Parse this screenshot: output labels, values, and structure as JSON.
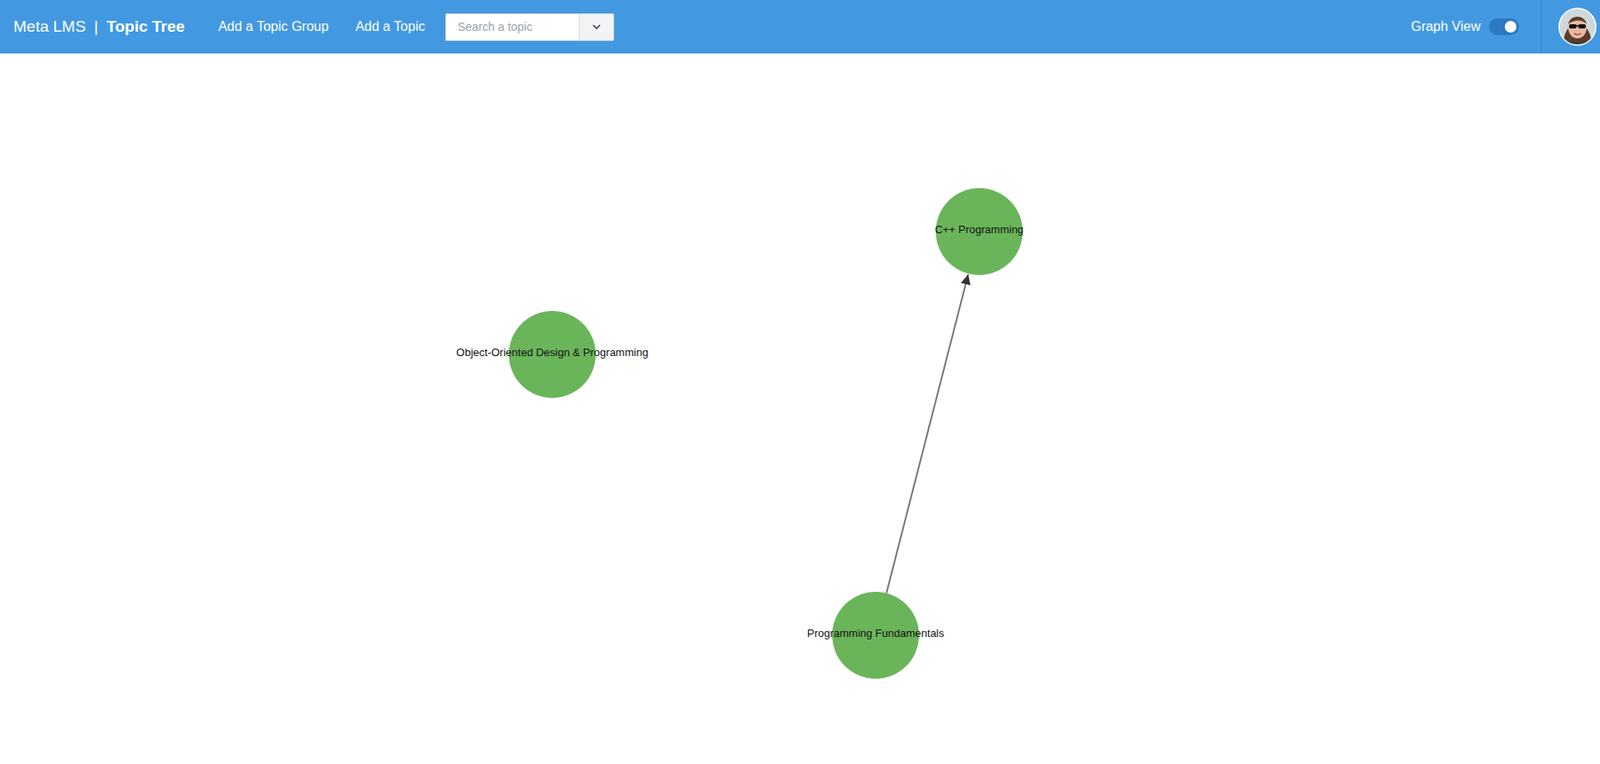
{
  "brand": {
    "product": "Meta LMS",
    "separator": "|",
    "page": "Topic Tree"
  },
  "nav": [
    "Add a Topic Group",
    "Add a Topic"
  ],
  "search": {
    "placeholder": "Search a topic"
  },
  "graphView": {
    "label": "Graph View",
    "on": true
  },
  "graph": {
    "nodes": [
      {
        "label": "C++ Programming",
        "color": "#6ab55a"
      },
      {
        "label": "Object-Oriented Design & Programming",
        "color": "#6ab55a"
      },
      {
        "label": "Programming Fundamentals",
        "color": "#6ab55a"
      }
    ],
    "edges": [
      {
        "from": 2,
        "to": 0
      }
    ]
  }
}
